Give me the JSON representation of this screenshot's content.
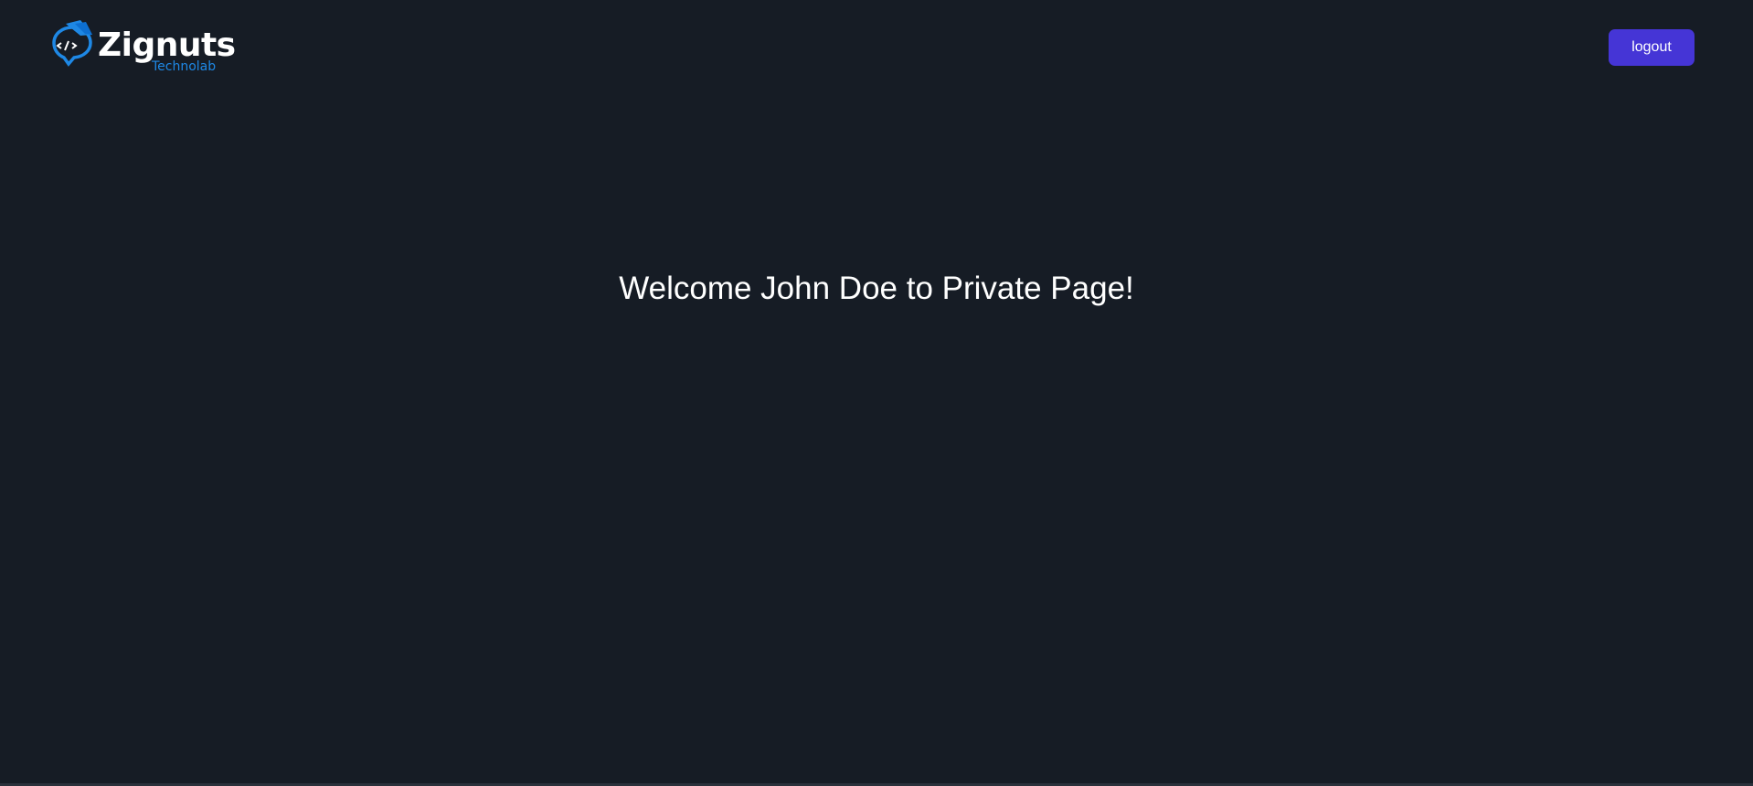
{
  "brand": {
    "name": "Zignuts",
    "tagline": "Technolab",
    "logo_icon": "code-bracket-bubble-icon",
    "colors": {
      "logo_primary": "#1e88e5",
      "logo_secondary": "#0d47a1"
    }
  },
  "header": {
    "logout_label": "logout"
  },
  "main": {
    "welcome_text": "Welcome John Doe to Private Page!"
  },
  "colors": {
    "background": "#161c25",
    "button": "#4535d6",
    "text": "#ffffff"
  }
}
